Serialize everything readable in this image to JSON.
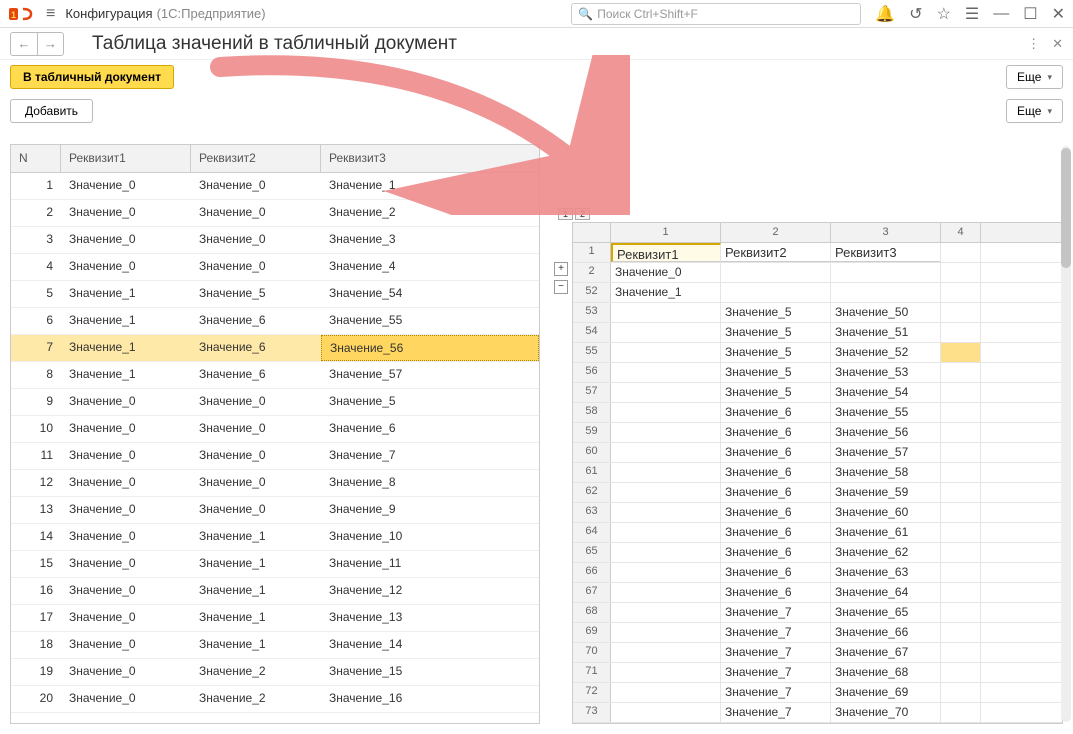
{
  "titlebar": {
    "app_title": "Конфигурация",
    "app_sub": "(1С:Предприятие)",
    "search_placeholder": "Поиск Ctrl+Shift+F"
  },
  "subheader": {
    "page_title": "Таблица значений в табличный документ"
  },
  "toolbar": {
    "to_doc": "В табличный документ",
    "add": "Добавить",
    "more": "Еще"
  },
  "left_table": {
    "headers": {
      "n": "N",
      "r1": "Реквизит1",
      "r2": "Реквизит2",
      "r3": "Реквизит3"
    },
    "rows": [
      {
        "n": 1,
        "r1": "Значение_0",
        "r2": "Значение_0",
        "r3": "Значение_1"
      },
      {
        "n": 2,
        "r1": "Значение_0",
        "r2": "Значение_0",
        "r3": "Значение_2"
      },
      {
        "n": 3,
        "r1": "Значение_0",
        "r2": "Значение_0",
        "r3": "Значение_3"
      },
      {
        "n": 4,
        "r1": "Значение_0",
        "r2": "Значение_0",
        "r3": "Значение_4"
      },
      {
        "n": 5,
        "r1": "Значение_1",
        "r2": "Значение_5",
        "r3": "Значение_54"
      },
      {
        "n": 6,
        "r1": "Значение_1",
        "r2": "Значение_6",
        "r3": "Значение_55"
      },
      {
        "n": 7,
        "r1": "Значение_1",
        "r2": "Значение_6",
        "r3": "Значение_56",
        "sel": true
      },
      {
        "n": 8,
        "r1": "Значение_1",
        "r2": "Значение_6",
        "r3": "Значение_57"
      },
      {
        "n": 9,
        "r1": "Значение_0",
        "r2": "Значение_0",
        "r3": "Значение_5"
      },
      {
        "n": 10,
        "r1": "Значение_0",
        "r2": "Значение_0",
        "r3": "Значение_6"
      },
      {
        "n": 11,
        "r1": "Значение_0",
        "r2": "Значение_0",
        "r3": "Значение_7"
      },
      {
        "n": 12,
        "r1": "Значение_0",
        "r2": "Значение_0",
        "r3": "Значение_8"
      },
      {
        "n": 13,
        "r1": "Значение_0",
        "r2": "Значение_0",
        "r3": "Значение_9"
      },
      {
        "n": 14,
        "r1": "Значение_0",
        "r2": "Значение_1",
        "r3": "Значение_10"
      },
      {
        "n": 15,
        "r1": "Значение_0",
        "r2": "Значение_1",
        "r3": "Значение_11"
      },
      {
        "n": 16,
        "r1": "Значение_0",
        "r2": "Значение_1",
        "r3": "Значение_12"
      },
      {
        "n": 17,
        "r1": "Значение_0",
        "r2": "Значение_1",
        "r3": "Значение_13"
      },
      {
        "n": 18,
        "r1": "Значение_0",
        "r2": "Значение_1",
        "r3": "Значение_14"
      },
      {
        "n": 19,
        "r1": "Значение_0",
        "r2": "Значение_2",
        "r3": "Значение_15"
      },
      {
        "n": 20,
        "r1": "Значение_0",
        "r2": "Значение_2",
        "r3": "Значение_16"
      }
    ]
  },
  "sheet": {
    "tabs": [
      "1",
      "2"
    ],
    "col_headers": [
      "1",
      "2",
      "3",
      "4"
    ],
    "header_row": {
      "rn": "1",
      "c1": "Реквизит1",
      "c2": "Реквизит2",
      "c3": "Реквизит3"
    },
    "rows": [
      {
        "rn": "2",
        "c1": "Значение_0",
        "c2": "",
        "c3": ""
      },
      {
        "rn": "52",
        "c1": "Значение_1",
        "c2": "",
        "c3": ""
      },
      {
        "rn": "53",
        "c1": "",
        "c2": "Значение_5",
        "c3": "Значение_50"
      },
      {
        "rn": "54",
        "c1": "",
        "c2": "Значение_5",
        "c3": "Значение_51"
      },
      {
        "rn": "55",
        "c1": "",
        "c2": "Значение_5",
        "c3": "Значение_52",
        "sel": true
      },
      {
        "rn": "56",
        "c1": "",
        "c2": "Значение_5",
        "c3": "Значение_53"
      },
      {
        "rn": "57",
        "c1": "",
        "c2": "Значение_5",
        "c3": "Значение_54"
      },
      {
        "rn": "58",
        "c1": "",
        "c2": "Значение_6",
        "c3": "Значение_55"
      },
      {
        "rn": "59",
        "c1": "",
        "c2": "Значение_6",
        "c3": "Значение_56"
      },
      {
        "rn": "60",
        "c1": "",
        "c2": "Значение_6",
        "c3": "Значение_57"
      },
      {
        "rn": "61",
        "c1": "",
        "c2": "Значение_6",
        "c3": "Значение_58"
      },
      {
        "rn": "62",
        "c1": "",
        "c2": "Значение_6",
        "c3": "Значение_59"
      },
      {
        "rn": "63",
        "c1": "",
        "c2": "Значение_6",
        "c3": "Значение_60"
      },
      {
        "rn": "64",
        "c1": "",
        "c2": "Значение_6",
        "c3": "Значение_61"
      },
      {
        "rn": "65",
        "c1": "",
        "c2": "Значение_6",
        "c3": "Значение_62"
      },
      {
        "rn": "66",
        "c1": "",
        "c2": "Значение_6",
        "c3": "Значение_63"
      },
      {
        "rn": "67",
        "c1": "",
        "c2": "Значение_6",
        "c3": "Значение_64"
      },
      {
        "rn": "68",
        "c1": "",
        "c2": "Значение_7",
        "c3": "Значение_65"
      },
      {
        "rn": "69",
        "c1": "",
        "c2": "Значение_7",
        "c3": "Значение_66"
      },
      {
        "rn": "70",
        "c1": "",
        "c2": "Значение_7",
        "c3": "Значение_67"
      },
      {
        "rn": "71",
        "c1": "",
        "c2": "Значение_7",
        "c3": "Значение_68"
      },
      {
        "rn": "72",
        "c1": "",
        "c2": "Значение_7",
        "c3": "Значение_69"
      },
      {
        "rn": "73",
        "c1": "",
        "c2": "Значение_7",
        "c3": "Значение_70"
      }
    ]
  }
}
